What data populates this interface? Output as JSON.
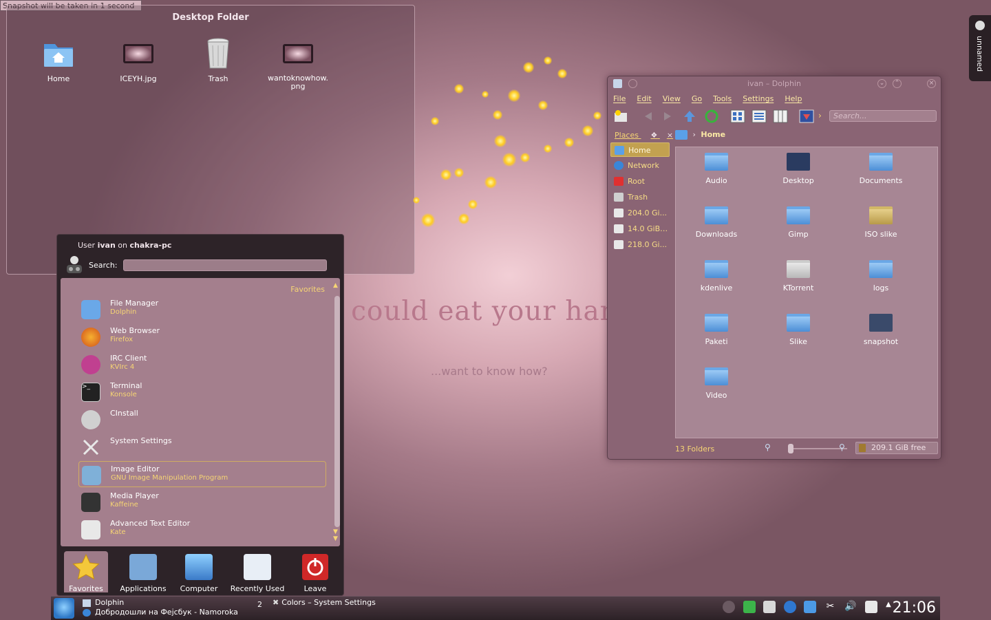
{
  "snapshot_tip": "Snapshot will be taken in 1 second",
  "desktop_folder": {
    "title": "Desktop Folder",
    "icons": [
      {
        "label": "Home",
        "icon": "home-folder-icon"
      },
      {
        "label": "ICEYH.jpg",
        "icon": "image-thumbnail-icon"
      },
      {
        "label": "Trash",
        "icon": "trash-icon"
      },
      {
        "label": "wantoknowhow.\npng",
        "icon": "image-thumbnail-icon"
      }
    ]
  },
  "wallpaper": {
    "headline": "t could eat your ham",
    "subline": "...want to know how?"
  },
  "dolphin": {
    "title": "ivan – Dolphin",
    "menu": [
      "File",
      "Edit",
      "View",
      "Go",
      "Tools",
      "Settings",
      "Help"
    ],
    "search_placeholder": "Search...",
    "places_header": "Places",
    "places": [
      {
        "label": "Home",
        "color": "#5aa0e8"
      },
      {
        "label": "Network",
        "color": "#3a86d8"
      },
      {
        "label": "Root",
        "color": "#e03030"
      },
      {
        "label": "Trash",
        "color": "#cfcfcf"
      },
      {
        "label": "204.0 Gi...",
        "color": "#e8e8e8"
      },
      {
        "label": "14.0 GiB ...",
        "color": "#e8e8e8"
      },
      {
        "label": "218.0 Gi...",
        "color": "#e8e8e8"
      }
    ],
    "breadcrumb": "Home",
    "files": [
      {
        "label": "Audio"
      },
      {
        "label": "Desktop"
      },
      {
        "label": "Documents"
      },
      {
        "label": "Downloads"
      },
      {
        "label": "Gimp"
      },
      {
        "label": "ISO slike"
      },
      {
        "label": "kdenlive"
      },
      {
        "label": "KTorrent"
      },
      {
        "label": "logs"
      },
      {
        "label": "Paketi"
      },
      {
        "label": "Slike"
      },
      {
        "label": "snapshot"
      },
      {
        "label": "Video"
      }
    ],
    "status": "13 Folders",
    "free_space": "209.1 GiB free"
  },
  "launcher": {
    "user_prefix": "User ",
    "user": "ivan",
    "user_on": " on ",
    "host": "chakra-pc",
    "search_label": "Search:",
    "favorites_label": "Favorites",
    "apps": [
      {
        "name": "File Manager",
        "desc": "Dolphin",
        "color": "#6aa8e8"
      },
      {
        "name": "Web Browser",
        "desc": "Firefox",
        "color": "#e0702a"
      },
      {
        "name": "IRC Client",
        "desc": "KVIrc 4",
        "color": "#c04090"
      },
      {
        "name": "Terminal",
        "desc": "Konsole",
        "color": "#222222"
      },
      {
        "name": "CInstall",
        "desc": "",
        "color": "#d0d0d0"
      },
      {
        "name": "System Settings",
        "desc": "",
        "color": "#b0b0b0"
      },
      {
        "name": "Image Editor",
        "desc": "GNU Image Manipulation Program",
        "color": "#7fb0d8"
      },
      {
        "name": "Media Player",
        "desc": "Kaffeine",
        "color": "#333333"
      },
      {
        "name": "Advanced Text Editor",
        "desc": "Kate",
        "color": "#e8e8e8"
      }
    ],
    "tabs": [
      {
        "label": "Favorites",
        "color": "#f4c83a"
      },
      {
        "label": "Applications",
        "color": "#7aa8d8"
      },
      {
        "label": "Computer",
        "color": "#5aa0e0"
      },
      {
        "label": "Recently Used",
        "color": "#e8eef6"
      },
      {
        "label": "Leave",
        "color": "#d02828"
      }
    ]
  },
  "taskbar": {
    "task1_line1": "Dolphin",
    "task1_line2": "Добродошли на Фејсбук - Namoroka",
    "task1_count": "2",
    "task2": "Colors – System Settings",
    "clock": "21:06"
  },
  "activity": "unnamed"
}
